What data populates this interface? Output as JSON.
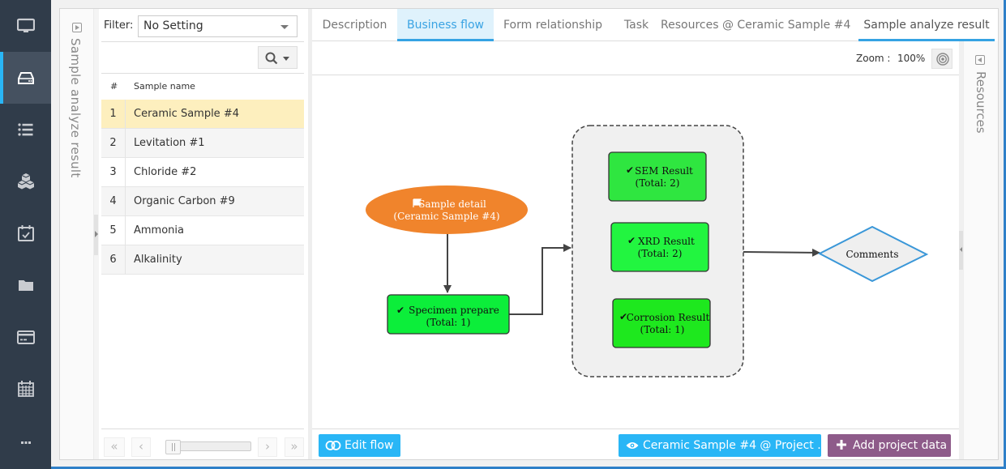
{
  "nav": {
    "items": [
      {
        "name": "monitor",
        "icon": "monitor-icon",
        "active": false
      },
      {
        "name": "storage",
        "icon": "hard-drive-icon",
        "active": true
      },
      {
        "name": "list",
        "icon": "list-icon",
        "active": false
      },
      {
        "name": "cubes",
        "icon": "cubes-icon",
        "active": false
      },
      {
        "name": "calendar-check",
        "icon": "calendar-check-icon",
        "active": false
      },
      {
        "name": "folder",
        "icon": "folder-icon",
        "active": false
      },
      {
        "name": "card",
        "icon": "credit-card-icon",
        "active": false
      },
      {
        "name": "calendar",
        "icon": "calendar-icon",
        "active": false
      },
      {
        "name": "more",
        "icon": "ellipsis-icon",
        "active": false
      }
    ]
  },
  "left_panel": {
    "collapsed_title": "Sample analyze result"
  },
  "sample_list": {
    "filter_label": "Filter:",
    "filter_value": "No Setting",
    "columns": [
      "#",
      "Sample name"
    ],
    "rows": [
      {
        "num": "1",
        "name": "Ceramic Sample #4",
        "selected": true
      },
      {
        "num": "2",
        "name": "Levitation #1",
        "selected": false
      },
      {
        "num": "3",
        "name": "Chloride #2",
        "selected": false
      },
      {
        "num": "4",
        "name": "Organic Carbon #9",
        "selected": false
      },
      {
        "num": "5",
        "name": "Ammonia",
        "selected": false
      },
      {
        "num": "6",
        "name": "Alkalinity",
        "selected": false
      }
    ],
    "pager": {
      "first": "«",
      "prev": "‹",
      "next": "›",
      "last": "»"
    }
  },
  "tabs": [
    {
      "label": "Description",
      "active": false
    },
    {
      "label": "Business flow",
      "active": true
    },
    {
      "label": "Form relationship",
      "active": false
    },
    {
      "label": "Task",
      "active": false
    },
    {
      "label": "Resources @ Ceramic Sample #4",
      "active": false
    },
    {
      "label": "Sample analyze result",
      "active": false
    }
  ],
  "toolbar": {
    "zoom_label": "Zoom :",
    "zoom_value": "100%"
  },
  "flow": {
    "start": {
      "line1": "Sample detail",
      "line2": "(Ceramic Sample #4)",
      "color": "#f0842c"
    },
    "specimen": {
      "line1": "Specimen prepare",
      "line2": "(Total: 1)",
      "color": "#0cee3a"
    },
    "group_nodes": [
      {
        "line1": "SEM Result",
        "line2": "(Total: 2)",
        "color": "#2fe640"
      },
      {
        "line1": "XRD Result",
        "line2": "(Total: 2)",
        "color": "#22f540"
      },
      {
        "line1": "Corrosion Result",
        "line2": "(Total: 1)",
        "color": "#1ee81e"
      }
    ],
    "end": {
      "label": "Comments",
      "color": "#3a97d8"
    }
  },
  "right_panel": {
    "collapsed_title": "Resources"
  },
  "footer": {
    "edit_flow": "Edit flow",
    "view_sample": "Ceramic Sample #4 @ Project ...",
    "add_project_data": "Add project data"
  }
}
